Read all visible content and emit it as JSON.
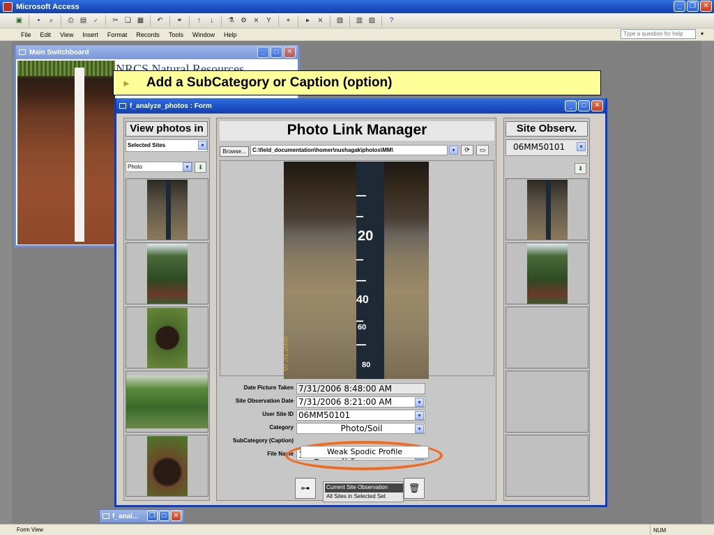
{
  "app": {
    "title": "Microsoft Access"
  },
  "menu": {
    "items": [
      "File",
      "Edit",
      "View",
      "Insert",
      "Format",
      "Records",
      "Tools",
      "Window",
      "Help"
    ],
    "help_placeholder": "Type a question for help"
  },
  "switchboard": {
    "title": "Main Switchboard",
    "logo_text": "NRCS Natural Resources"
  },
  "callout": {
    "text": "Add a SubCategory or Caption (option)"
  },
  "form": {
    "title": "f_analyze_photos : Form",
    "left": {
      "heading": "View photos in",
      "sites_value": "Selected Sites",
      "photo_value": "Photo"
    },
    "center": {
      "heading": "Photo Link Manager",
      "browse_label": "Browse...",
      "path_value": "C:\\field_documentation\\homer\\nushagak\\photos\\MM\\",
      "tape_numbers": [
        "20",
        "40",
        "60",
        "80"
      ],
      "photo_date": "07.31.2006",
      "fields": [
        {
          "label": "Date Picture Taken",
          "value": "7/31/2006 8:48:00 AM"
        },
        {
          "label": "Site Observation Date",
          "value": "7/31/2006 8:21:00 AM"
        },
        {
          "label": "User Site ID",
          "value": "06MM50101"
        },
        {
          "label": "Category",
          "value": "Photo/Soil"
        },
        {
          "label": "SubCategory (Caption)",
          "value": "Weak Spodic Profile"
        },
        {
          "label": "File Name",
          "value": "100_7005.jpg"
        }
      ],
      "option_selected": "Current Site Observation",
      "option_other": "All Sites in Selected Set"
    },
    "right": {
      "heading": "Site Observ.",
      "site_value": "06MM50101"
    }
  },
  "minimized": {
    "title": "f_anal..."
  },
  "status": {
    "left": "Form View",
    "right": "NUM"
  },
  "colors": {
    "titlebar": "#1b4fc2",
    "callout_bg": "#ffff99",
    "oval": "#f26a1b"
  }
}
